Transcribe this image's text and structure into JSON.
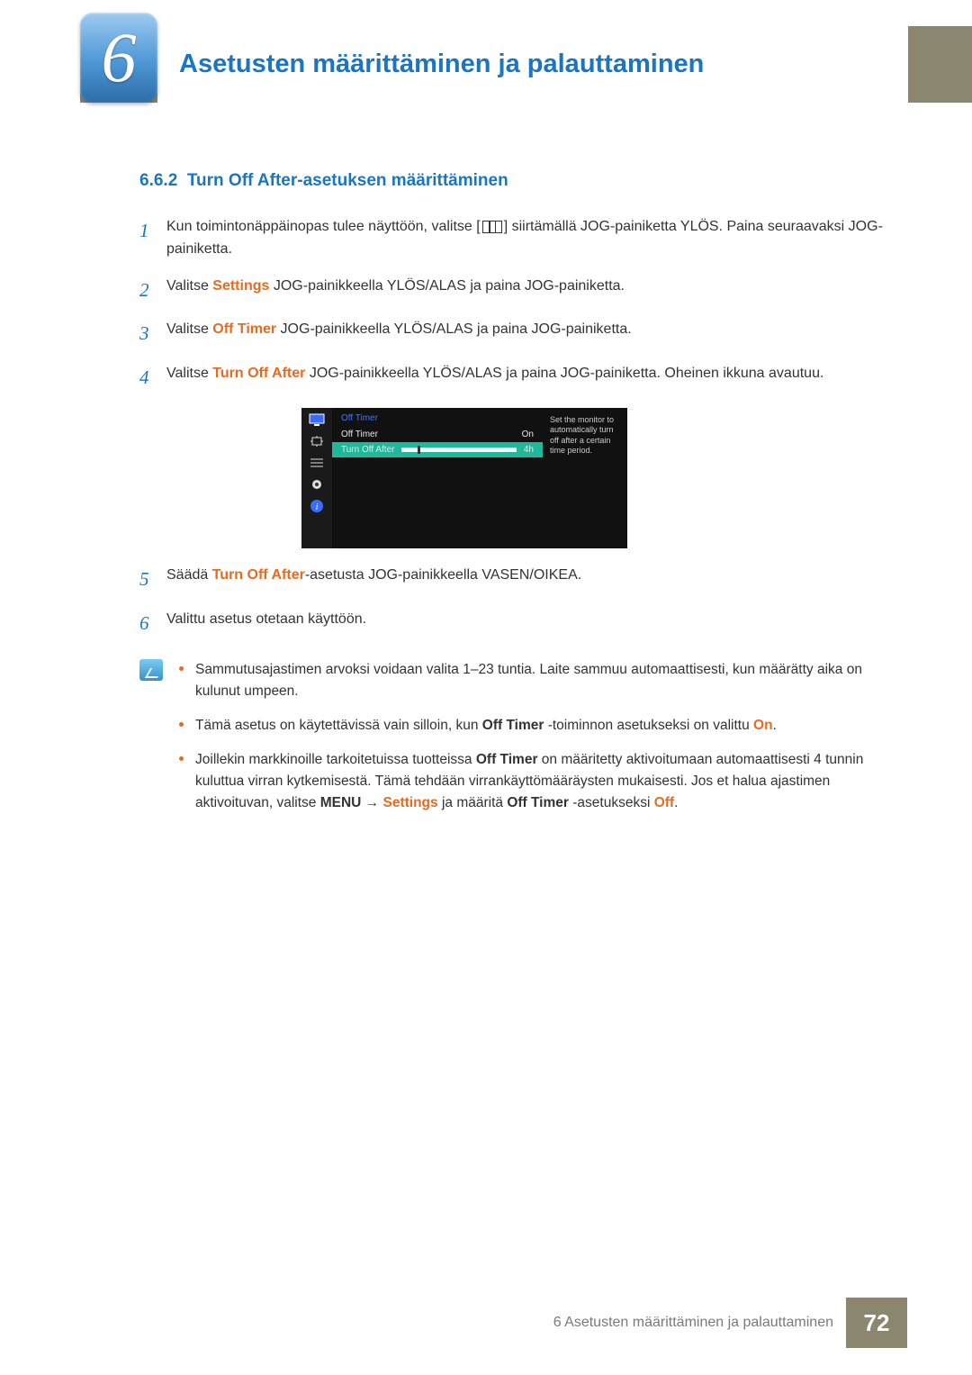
{
  "chapter": {
    "number": "6",
    "title": "Asetusten määrittäminen ja palauttaminen"
  },
  "section": {
    "number": "6.6.2",
    "title": "Turn Off After-asetuksen määrittäminen"
  },
  "steps": {
    "s1a": "Kun toimintonäppäinopas tulee näyttöön, valitse [",
    "s1b": "] siirtämällä JOG-painiketta YLÖS. Paina seuraavaksi JOG-painiketta.",
    "s2a": "Valitse ",
    "s2_settings": "Settings",
    "s2b": " JOG-painikkeella YLÖS/ALAS ja paina JOG-painiketta.",
    "s3a": "Valitse ",
    "s3_off_timer": "Off Timer",
    "s3b": " JOG-painikkeella YLÖS/ALAS ja paina JOG-painiketta.",
    "s4a": "Valitse ",
    "s4_turn_off_after": "Turn Off After",
    "s4b": " JOG-painikkeella YLÖS/ALAS ja paina JOG-painiketta. Oheinen ikkuna avautuu.",
    "s5a": "Säädä ",
    "s5_turn_off_after": "Turn Off After",
    "s5b": "-asetusta JOG-painikkeella VASEN/OIKEA.",
    "s6": "Valittu asetus otetaan käyttöön."
  },
  "osd": {
    "title": "Off Timer",
    "row1_label": "Off Timer",
    "row1_value": "On",
    "row2_label": "Turn Off After",
    "row2_value": "4h",
    "help": "Set the monitor to automatically turn off after a certain time period."
  },
  "notes": {
    "n1": "Sammutusajastimen arvoksi voidaan valita 1–23 tuntia. Laite sammuu automaattisesti, kun määrätty aika on kulunut umpeen.",
    "n2a": "Tämä asetus on käytettävissä vain silloin, kun ",
    "n2_off_timer": "Off Timer",
    "n2b": " -toiminnon asetukseksi on valittu ",
    "n2_on": "On",
    "n2c": ".",
    "n3a": "Joillekin markkinoille tarkoitetuissa tuotteissa ",
    "n3_off_timer": "Off Timer",
    "n3b": " on määritetty aktivoitumaan automaattisesti 4 tunnin kuluttua virran kytkemisestä. Tämä tehdään virrankäyttömääräysten mukaisesti. Jos et halua ajastimen aktivoituvan, valitse ",
    "n3_menu": "MENU",
    "n3_arrow": " → ",
    "n3_settings": "Settings",
    "n3c": " ja määritä ",
    "n3_off_timer2": "Off Timer",
    "n3d": " -asetukseksi ",
    "n3_off": "Off",
    "n3e": "."
  },
  "footer": {
    "text": "6 Asetusten määrittäminen ja palauttaminen",
    "page": "72"
  }
}
